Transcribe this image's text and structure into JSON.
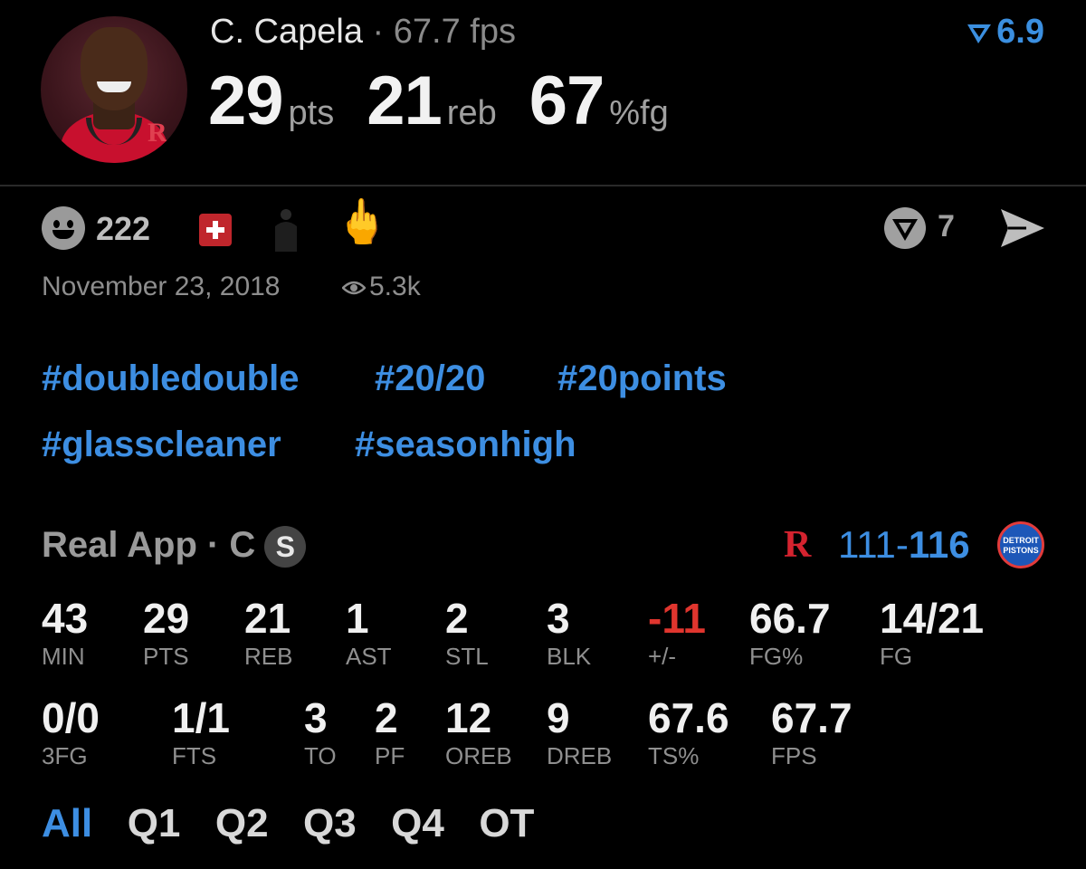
{
  "player": {
    "name": "C. Capela",
    "separator": "·",
    "fps": "67.7 fps",
    "rating": "6.9",
    "highlights": [
      {
        "value": "29",
        "unit": "pts"
      },
      {
        "value": "21",
        "unit": "reb"
      },
      {
        "value": "67",
        "unit": "%fg"
      }
    ]
  },
  "reactions": {
    "count": "222",
    "verified_count": "7",
    "date": "November 23, 2018",
    "views": "5.3k"
  },
  "hashtags": [
    "#doubledouble",
    "#20/20",
    "#20points",
    "#glasscleaner",
    "#seasonhigh"
  ],
  "game": {
    "source": "Real App · C",
    "source_badge": "S",
    "score_home": "111",
    "score_dash": "-",
    "score_away": "116",
    "away_logo_text": "DETROIT PISTONS"
  },
  "stats_row1": [
    {
      "value": "43",
      "label": "MIN"
    },
    {
      "value": "29",
      "label": "PTS"
    },
    {
      "value": "21",
      "label": "REB"
    },
    {
      "value": "1",
      "label": "AST"
    },
    {
      "value": "2",
      "label": "STL"
    },
    {
      "value": "3",
      "label": "BLK"
    },
    {
      "value": "-11",
      "label": "+/-"
    },
    {
      "value": "66.7",
      "label": "FG%"
    },
    {
      "value": "14/21",
      "label": "FG"
    }
  ],
  "stats_row2": [
    {
      "value": "0/0",
      "label": "3FG"
    },
    {
      "value": "1/1",
      "label": "FTS"
    },
    {
      "value": "3",
      "label": "TO"
    },
    {
      "value": "2",
      "label": "PF"
    },
    {
      "value": "12",
      "label": "OREB"
    },
    {
      "value": "9",
      "label": "DREB"
    },
    {
      "value": "67.6",
      "label": "TS%"
    },
    {
      "value": "67.7",
      "label": "FPS"
    }
  ],
  "tabs": [
    "All",
    "Q1",
    "Q2",
    "Q3",
    "Q4",
    "OT"
  ],
  "colors": {
    "accent": "#3d8ee2",
    "negative": "#e0352e",
    "background": "#000000"
  }
}
